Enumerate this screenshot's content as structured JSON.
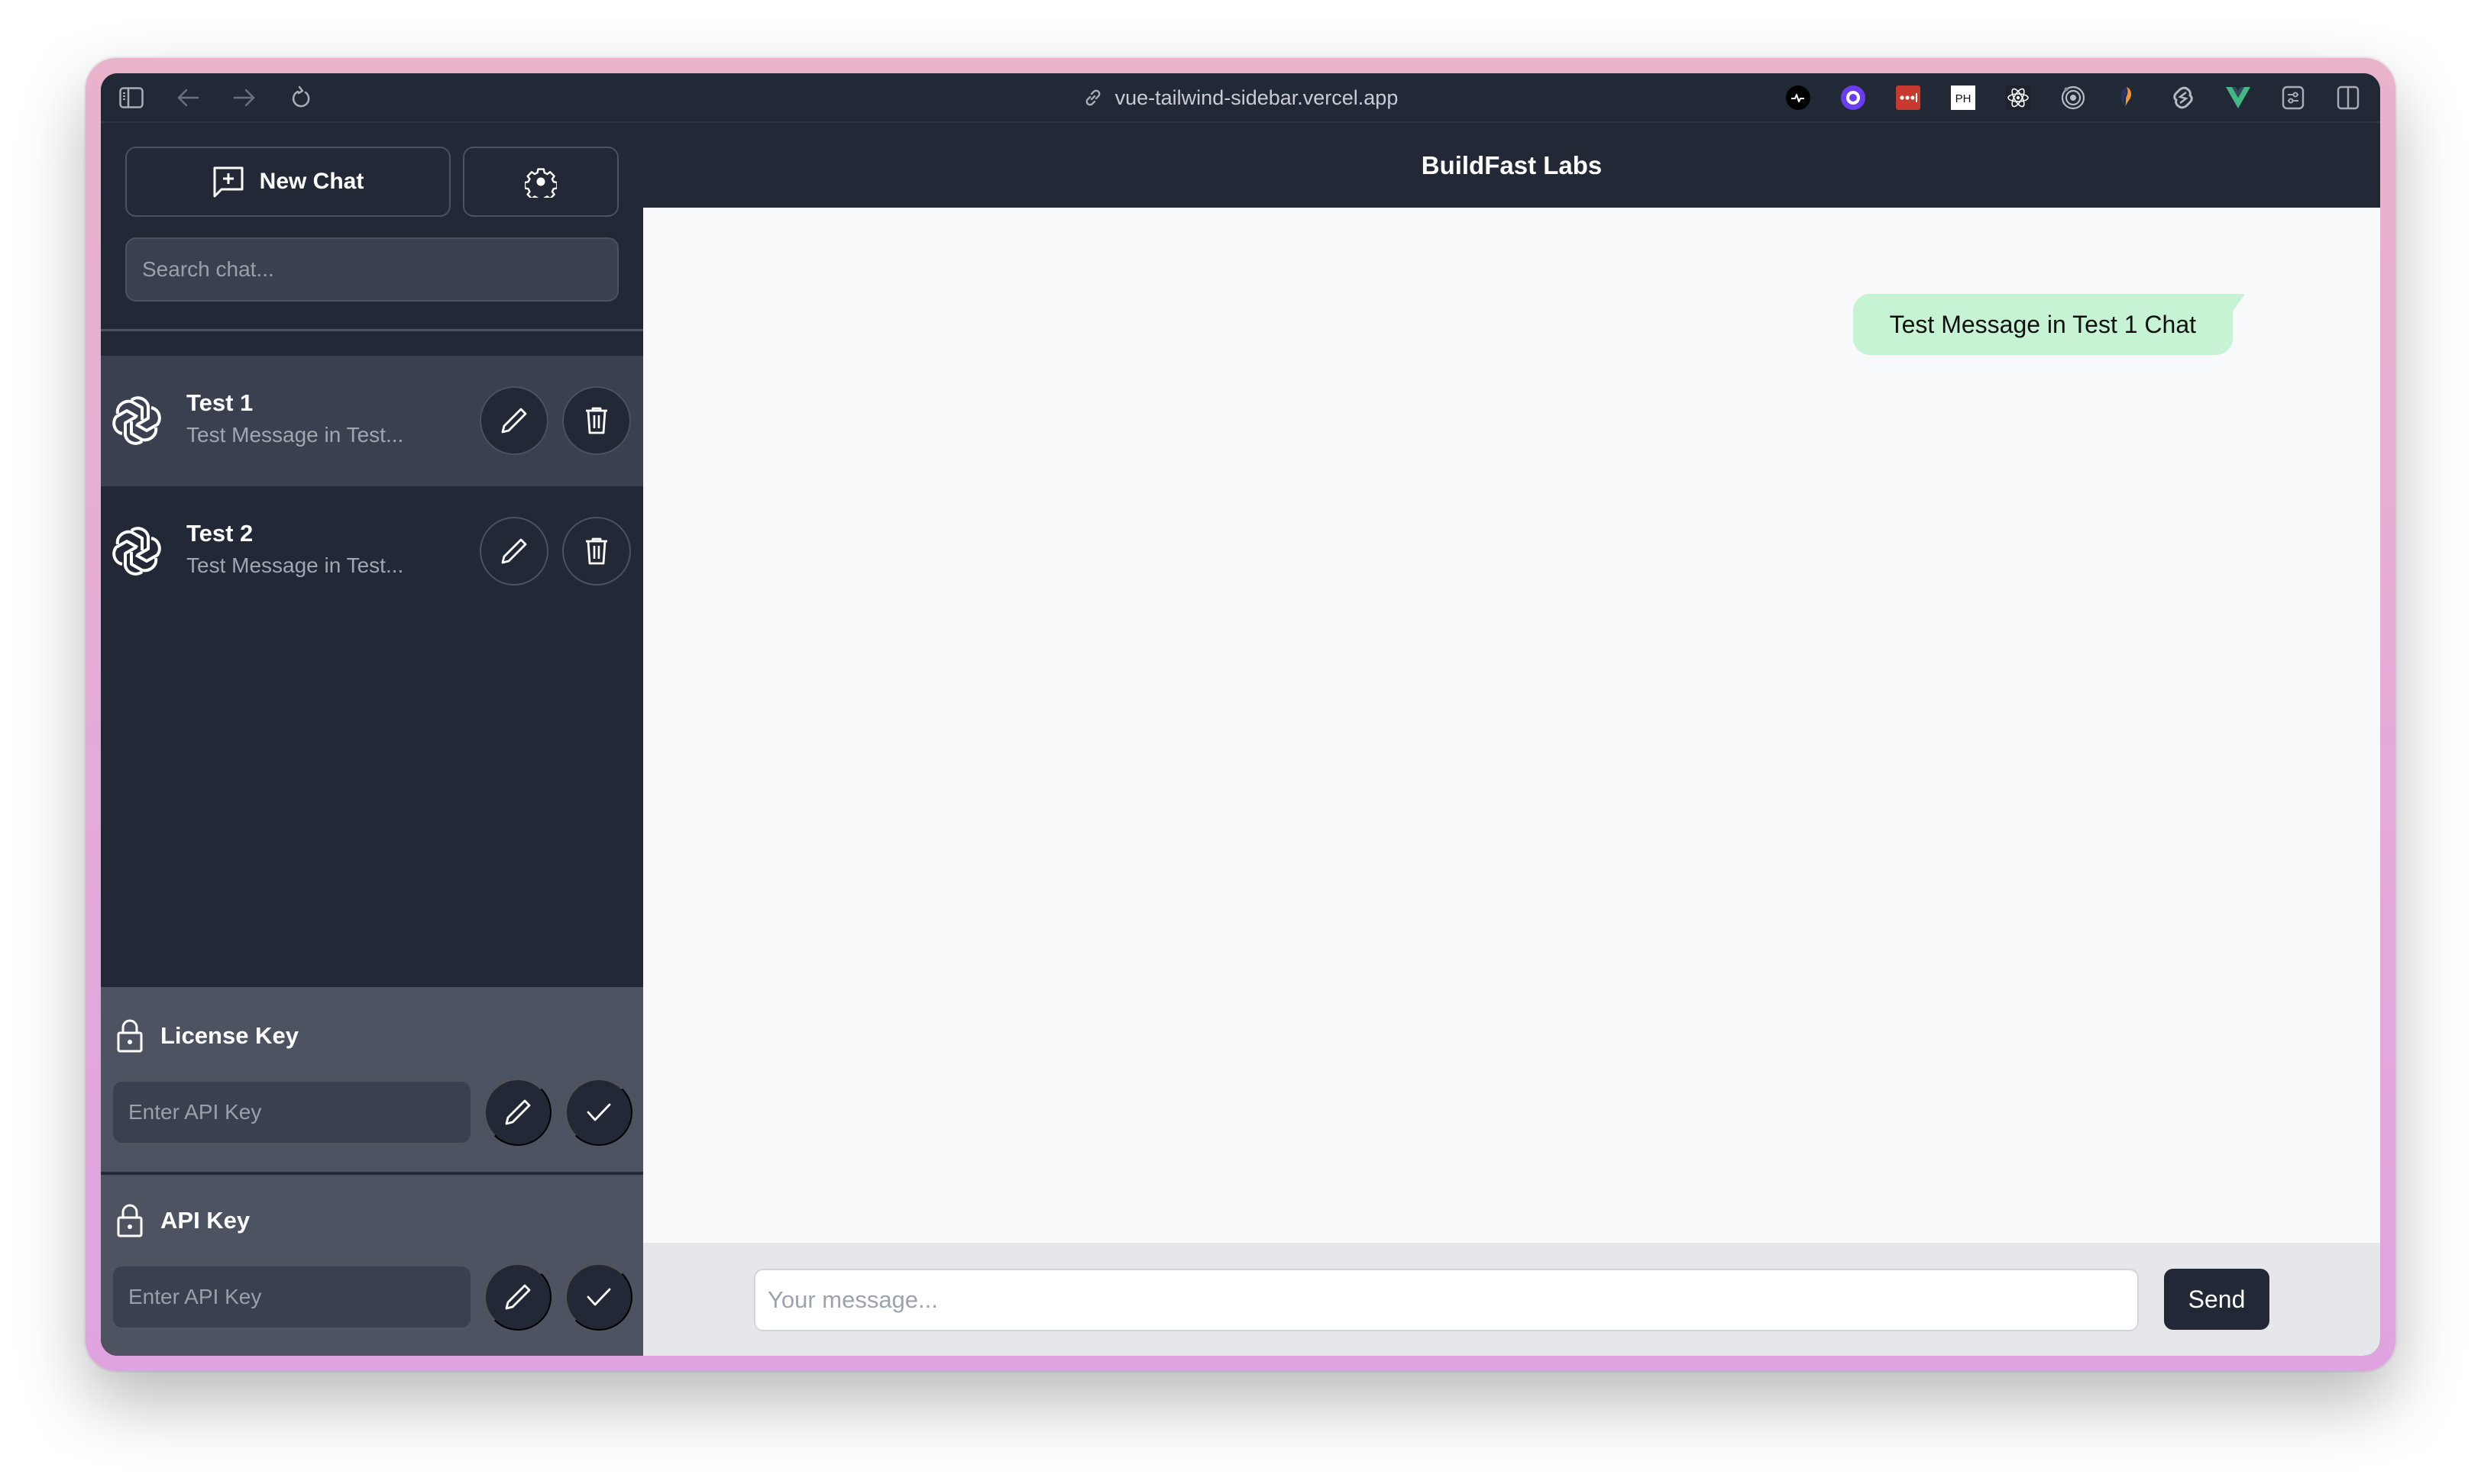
{
  "browser": {
    "url": "vue-tailwind-sidebar.vercel.app",
    "toolbar_icons": [
      "sidebar-toggle-icon",
      "back-arrow-icon",
      "forward-arrow-icon",
      "reload-icon"
    ],
    "extensions": [
      {
        "name": "pulse-extension-icon",
        "label": ""
      },
      {
        "name": "purple-circle-extension-icon",
        "label": ""
      },
      {
        "name": "lastpass-extension-icon",
        "label": "•••|"
      },
      {
        "name": "producthunt-extension-icon",
        "label": "PH"
      },
      {
        "name": "react-devtools-extension-icon",
        "label": ""
      },
      {
        "name": "target-extension-icon",
        "label": ""
      },
      {
        "name": "orange-swirl-extension-icon",
        "label": ""
      },
      {
        "name": "svelte-extension-icon",
        "label": ""
      },
      {
        "name": "vue-devtools-extension-icon",
        "label": ""
      },
      {
        "name": "extensions-menu-icon",
        "label": ""
      },
      {
        "name": "split-view-icon",
        "label": ""
      }
    ]
  },
  "sidebar": {
    "new_chat_label": "New Chat",
    "search_placeholder": "Search chat...",
    "chats": [
      {
        "title": "Test 1",
        "preview": "Test Message in Test...",
        "active": true
      },
      {
        "title": "Test 2",
        "preview": "Test Message in Test...",
        "active": false
      }
    ],
    "keys": [
      {
        "label": "License Key",
        "placeholder": "Enter API Key"
      },
      {
        "label": "API Key",
        "placeholder": "Enter API Key"
      }
    ]
  },
  "header": {
    "title": "BuildFast Labs"
  },
  "chat": {
    "messages": [
      {
        "text": "Test Message in Test 1 Chat",
        "from": "user"
      }
    ],
    "input_placeholder": "Your message...",
    "send_label": "Send"
  },
  "colors": {
    "sidebar_bg": "#222836",
    "active_item_bg": "#3a404f",
    "key_section_bg": "#4d5361",
    "chat_bg": "#f8f9fb",
    "bubble_bg": "#c6f3d3",
    "input_bar_bg": "#e5e7eb"
  }
}
